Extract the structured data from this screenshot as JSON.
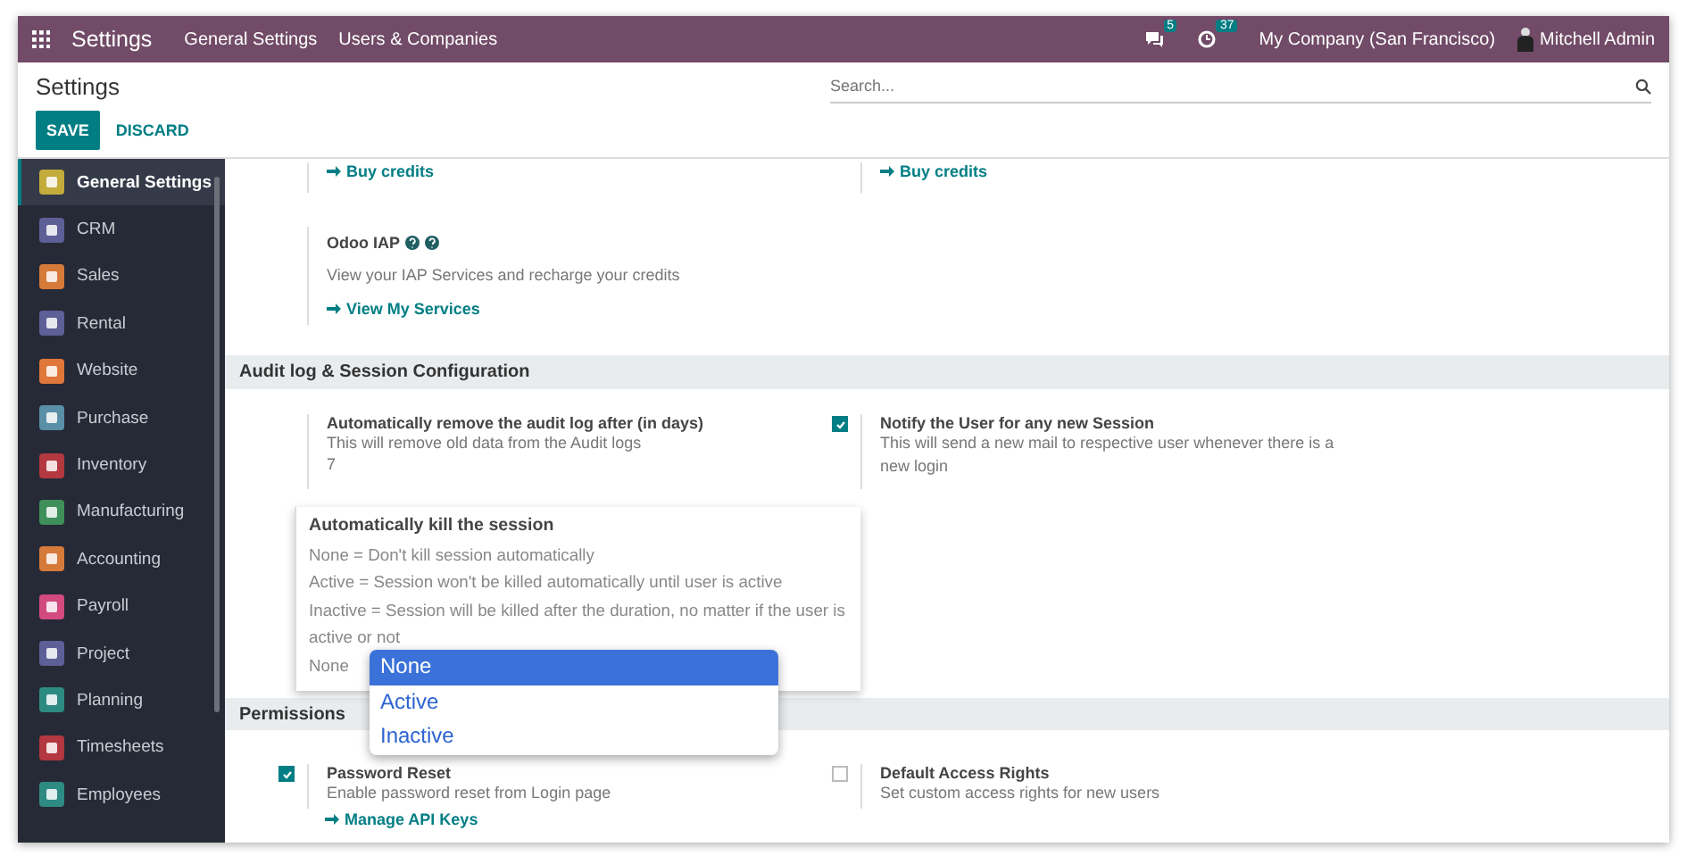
{
  "top_bar": {
    "app_name": "Settings",
    "menu": [
      "General Settings",
      "Users & Companies"
    ],
    "messages_count": "5",
    "activities_count": "37",
    "company": "My Company (San Francisco)",
    "user": "Mitchell Admin"
  },
  "control_panel": {
    "title": "Settings",
    "search": {
      "placeholder": "Search..."
    },
    "buttons": [
      {
        "label": "SAVE",
        "kind": "primary"
      },
      {
        "label": "DISCARD",
        "kind": "link"
      }
    ]
  },
  "sidebar": {
    "items": [
      {
        "label": "General Settings",
        "selected": true,
        "color": "#c3ab3c"
      },
      {
        "label": "CRM",
        "selected": false,
        "color": "#5d5f97"
      },
      {
        "label": "Sales",
        "selected": false,
        "color": "#d67a3a"
      },
      {
        "label": "Rental",
        "selected": false,
        "color": "#5d5f97"
      },
      {
        "label": "Website",
        "selected": false,
        "color": "#e0773a"
      },
      {
        "label": "Purchase",
        "selected": false,
        "color": "#5a8fa8"
      },
      {
        "label": "Inventory",
        "selected": false,
        "color": "#b3383f"
      },
      {
        "label": "Manufacturing",
        "selected": false,
        "color": "#3f8f5a"
      },
      {
        "label": "Accounting",
        "selected": false,
        "color": "#d67a3a"
      },
      {
        "label": "Payroll",
        "selected": false,
        "color": "#d24a80"
      },
      {
        "label": "Project",
        "selected": false,
        "color": "#5d5f97"
      },
      {
        "label": "Planning",
        "selected": false,
        "color": "#2e8b84"
      },
      {
        "label": "Timesheets",
        "selected": false,
        "color": "#b3383f"
      },
      {
        "label": "Employees",
        "selected": false,
        "color": "#2e8b84"
      }
    ]
  },
  "content": {
    "credit_links": [
      "Buy credits",
      "Buy credits"
    ],
    "iap": {
      "title": "Odoo IAP",
      "description": "View your IAP Services and recharge your credits",
      "link": "View My Services"
    },
    "audit_section": {
      "title": "Audit log & Session Configuration",
      "settings": [
        {
          "kind": "value",
          "title": "Automatically remove the audit log after (in days)",
          "description": "This will remove old data from the Audit logs",
          "value": "7"
        },
        {
          "kind": "checkbox",
          "checked": true,
          "title": "Notify the User for any new Session",
          "description": "This will send a new mail to respective user whenever there is a new login"
        }
      ]
    },
    "kill_session": {
      "title": "Automatically kill the session",
      "lines": [
        "None = Don't kill session automatically",
        "Active = Session won't be killed automatically until user is active",
        "Inactive = Session will be killed after the duration, no matter if the user is active or not"
      ],
      "value": "None",
      "dropdown": [
        {
          "label": "None",
          "selected": true
        },
        {
          "label": "Active",
          "selected": false
        },
        {
          "label": "Inactive",
          "selected": false
        }
      ]
    },
    "permissions_section": {
      "title": "Permissions",
      "settings": [
        {
          "kind": "checkbox",
          "checked": true,
          "title": "Password Reset",
          "description": "Enable password reset from Login page"
        },
        {
          "kind": "checkbox",
          "checked": false,
          "title": "Default Access Rights",
          "description": "Set custom access rights for new users"
        }
      ],
      "link": "Manage API Keys"
    }
  }
}
